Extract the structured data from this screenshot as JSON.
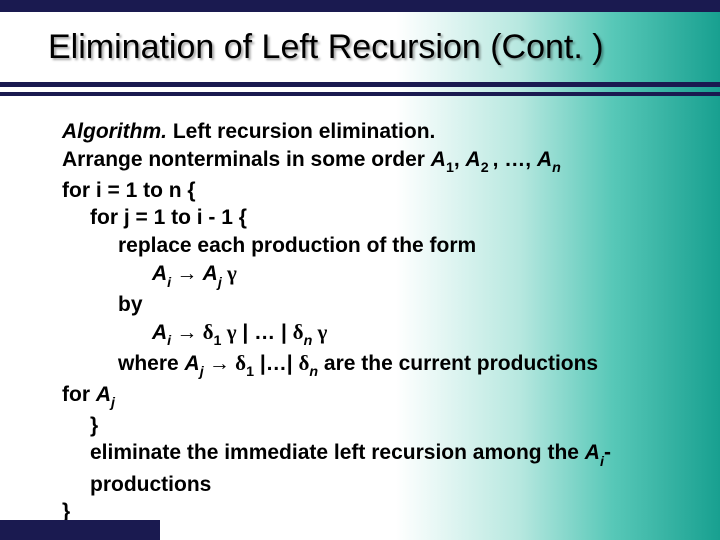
{
  "title": "Elimination of Left Recursion (Cont. )",
  "algo": {
    "heading_label": "Algorithm.",
    "heading_text": " Left recursion elimination.",
    "arrange_prefix": "Arrange nonterminals in some order ",
    "A": "A",
    "sub1": "1",
    "comma": ", ",
    "sub2": "2 ",
    "midlist": ", …, ",
    "subn": "n",
    "for_i": "for i = 1 to n {",
    "for_j": "for j = 1 to i - 1 {",
    "replace": "replace each production of the form",
    "subi": "i",
    "arrow": " → ",
    "subj": "j",
    "gamma": " γ",
    "by": "by",
    "delta": "δ",
    "bar_mid": " | … | ",
    "where_pref": "where ",
    "where_mid": " |…| ",
    "where_suf": " are the current productions",
    "for_Aj_pref": "for ",
    "close": "}",
    "eliminate_l1": "eliminate the immediate left recursion among the ",
    "eliminate_l1_suffix": "-",
    "eliminate_l2": "productions"
  }
}
